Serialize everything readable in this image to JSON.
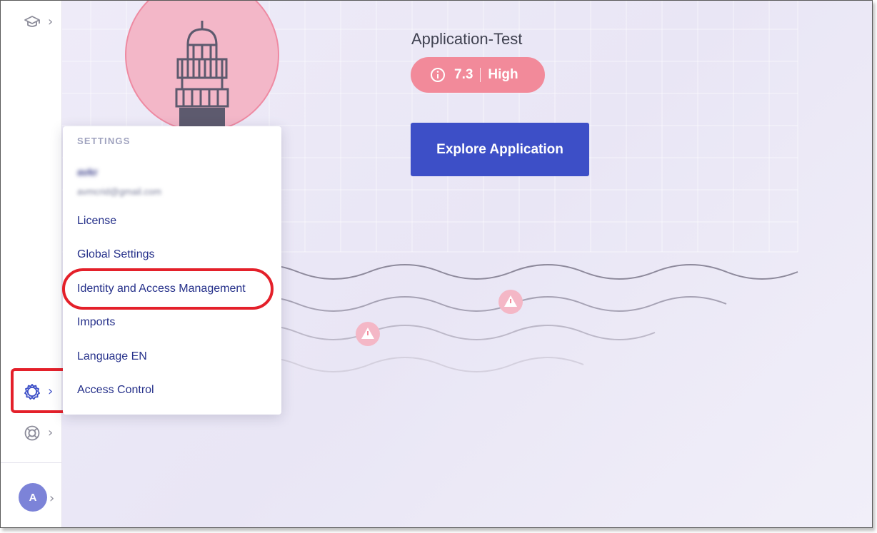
{
  "sidebar": {
    "top_icon": "graduation-cap-icon",
    "settings_icon": "gear-icon",
    "help_icon": "lifebuoy-icon",
    "chevron": "›",
    "avatar_initial": "A"
  },
  "application": {
    "name": "Application-Test",
    "risk_score": "7.3",
    "risk_level": "High",
    "risk_color": "#f28a9a",
    "explore_label": "Explore Application",
    "accent_color": "#3d4fc7"
  },
  "settings_menu": {
    "header": "SETTINGS",
    "user_name": "avkr",
    "user_email": "avmcrid@gmail.com",
    "items": [
      {
        "label": "License"
      },
      {
        "label": "Global Settings"
      },
      {
        "label": "Identity and Access Management"
      },
      {
        "label": "Imports"
      },
      {
        "label": "Language EN"
      },
      {
        "label": "Access Control"
      }
    ]
  }
}
